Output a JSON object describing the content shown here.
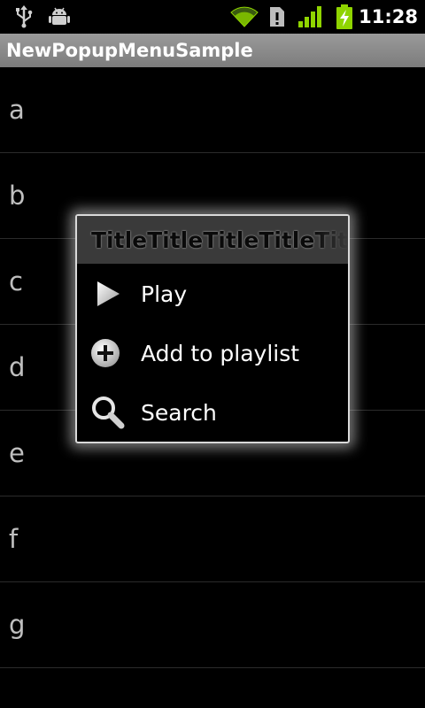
{
  "status_bar": {
    "time": "11:28",
    "icons": [
      "usb-icon",
      "android-debug-icon",
      "wifi-icon",
      "sim-icon",
      "signal-icon",
      "battery-charging-icon"
    ]
  },
  "app": {
    "title": "NewPopupMenuSample"
  },
  "list": {
    "items": [
      {
        "label": "a"
      },
      {
        "label": "b"
      },
      {
        "label": "c"
      },
      {
        "label": "d"
      },
      {
        "label": "e"
      },
      {
        "label": "f"
      },
      {
        "label": "g"
      }
    ]
  },
  "popup": {
    "title": "TitleTitleTitleTitleTitle",
    "items": [
      {
        "label": "Play",
        "icon": "play-icon"
      },
      {
        "label": "Add to playlist",
        "icon": "add-icon"
      },
      {
        "label": "Search",
        "icon": "search-icon"
      }
    ]
  },
  "colors": {
    "background": "#000000",
    "title_bar": "#8a8a8a",
    "popup_header": "#3a3a3a",
    "popup_border": "#d9d9d9",
    "battery": "#8fd400",
    "signal": "#8fd400"
  }
}
